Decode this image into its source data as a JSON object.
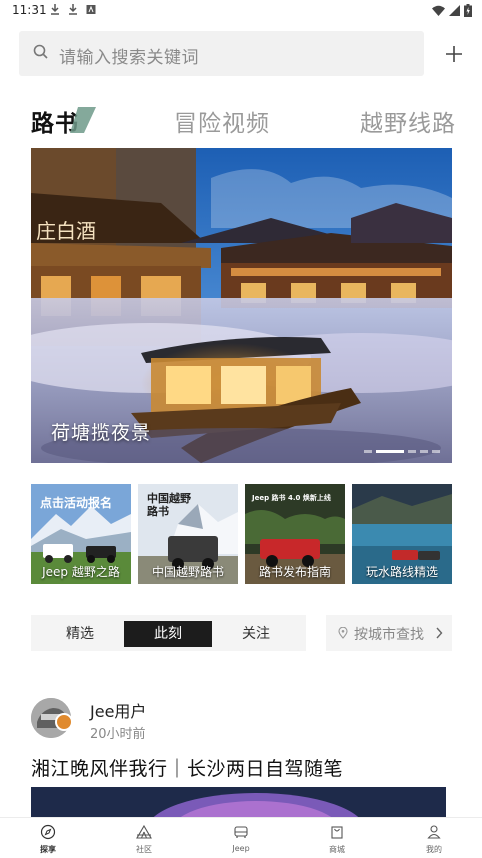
{
  "status_bar": {
    "time": "11:31"
  },
  "search": {
    "placeholder": "请输入搜索关键词"
  },
  "tabs": [
    {
      "label": "路书",
      "active": true
    },
    {
      "label": "冒险视频",
      "active": false
    },
    {
      "label": "越野线路",
      "active": false
    }
  ],
  "banner": {
    "caption": "荷塘揽夜景",
    "sign_text": "庄白酒",
    "slide_count": 5,
    "active_slide": 1
  },
  "shortcuts": [
    {
      "title": "点击活动报名",
      "label": "Jeep 越野之路"
    },
    {
      "title": "中国越野\n路书",
      "label": "中国越野路书"
    },
    {
      "title": "Jeep 路书 4.0 焕新上线",
      "label": "路书发布指南"
    },
    {
      "title": "",
      "label": "玩水路线精选"
    }
  ],
  "feed_tabs": [
    {
      "label": "精选",
      "active": false
    },
    {
      "label": "此刻",
      "active": true
    },
    {
      "label": "关注",
      "active": false
    }
  ],
  "city_filter": {
    "label": "按城市查找"
  },
  "post": {
    "user": "Jee用户",
    "time": "20小时前",
    "title": "湘江晚风伴我行｜长沙两日自驾随笔"
  },
  "bottom_nav": [
    {
      "label": "探享",
      "icon": "compass-icon",
      "active": true
    },
    {
      "label": "社区",
      "icon": "tent-icon",
      "active": false
    },
    {
      "label": "Jeep",
      "icon": "car-icon",
      "active": false
    },
    {
      "label": "商城",
      "icon": "shopping-bag-icon",
      "active": false
    },
    {
      "label": "我的",
      "icon": "person-icon",
      "active": false
    }
  ],
  "colors": {
    "accent_green": "#6f9a8a",
    "active_dark": "#1c1c1c",
    "badge_orange": "#e08a2e"
  }
}
